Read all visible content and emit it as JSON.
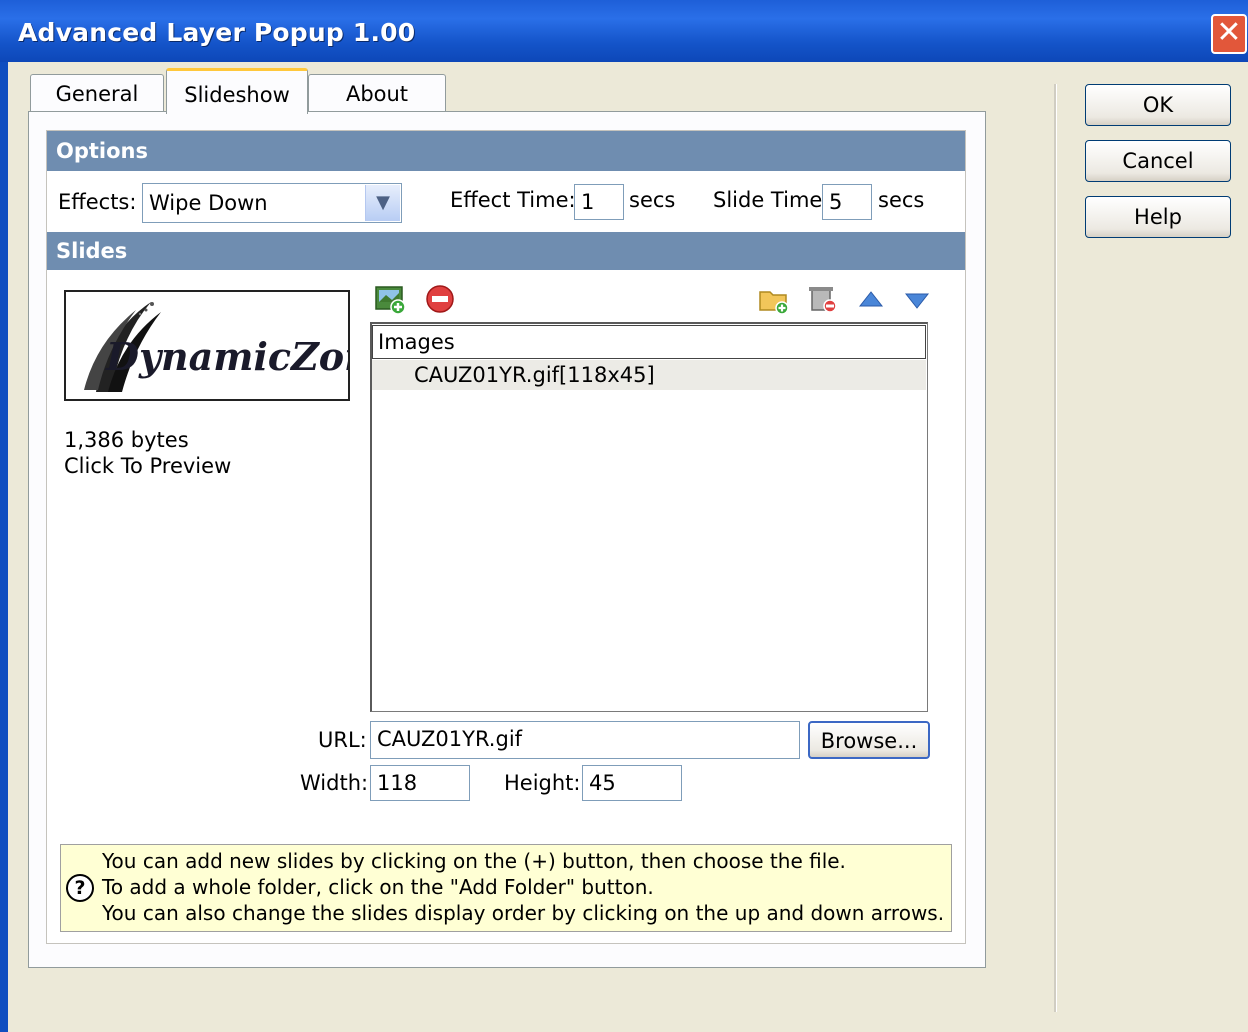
{
  "window": {
    "title": "Advanced Layer Popup 1.00",
    "close_glyph": "✕"
  },
  "tabs": [
    {
      "label": "General"
    },
    {
      "label": "Slideshow",
      "active": true
    },
    {
      "label": "About"
    }
  ],
  "options": {
    "header": "Options",
    "effects_label": "Effects:",
    "effects_value": "Wipe Down",
    "effect_time_label": "Effect Time:",
    "effect_time_value": "1",
    "effect_time_unit": "secs",
    "slide_time_label": "Slide Time:",
    "slide_time_value": "5",
    "slide_time_unit": "secs"
  },
  "slides": {
    "header": "Slides",
    "preview_logo_text": "DynamicZones",
    "file_size": "1,386 bytes",
    "preview_hint": "Click To Preview",
    "list_header": "Images",
    "items": [
      "CAUZ01YR.gif[118x45]"
    ],
    "url_label": "URL:",
    "url_value": "CAUZ01YR.gif",
    "browse_label": "Browse...",
    "width_label": "Width:",
    "width_value": "118",
    "height_label": "Height:",
    "height_value": "45"
  },
  "toolbar_icons": [
    "add-image-icon",
    "remove-icon",
    "add-folder-icon",
    "remove-folder-icon",
    "move-up-icon",
    "move-down-icon"
  ],
  "buttons": {
    "ok": "OK",
    "cancel": "Cancel",
    "help": "Help"
  },
  "hint": {
    "icon_glyph": "?",
    "line1": "You can add new slides by clicking on the (+) button, then choose the file.",
    "line2": "To add a whole folder, click on the \"Add Folder\" button.",
    "line3": "You can also change the slides display order by clicking on the up and down arrows."
  },
  "colors": {
    "titlebar": "#1e5fd8",
    "section_header": "#6f8db0",
    "hint_bg": "#ffffd4",
    "close": "#e2573a"
  }
}
